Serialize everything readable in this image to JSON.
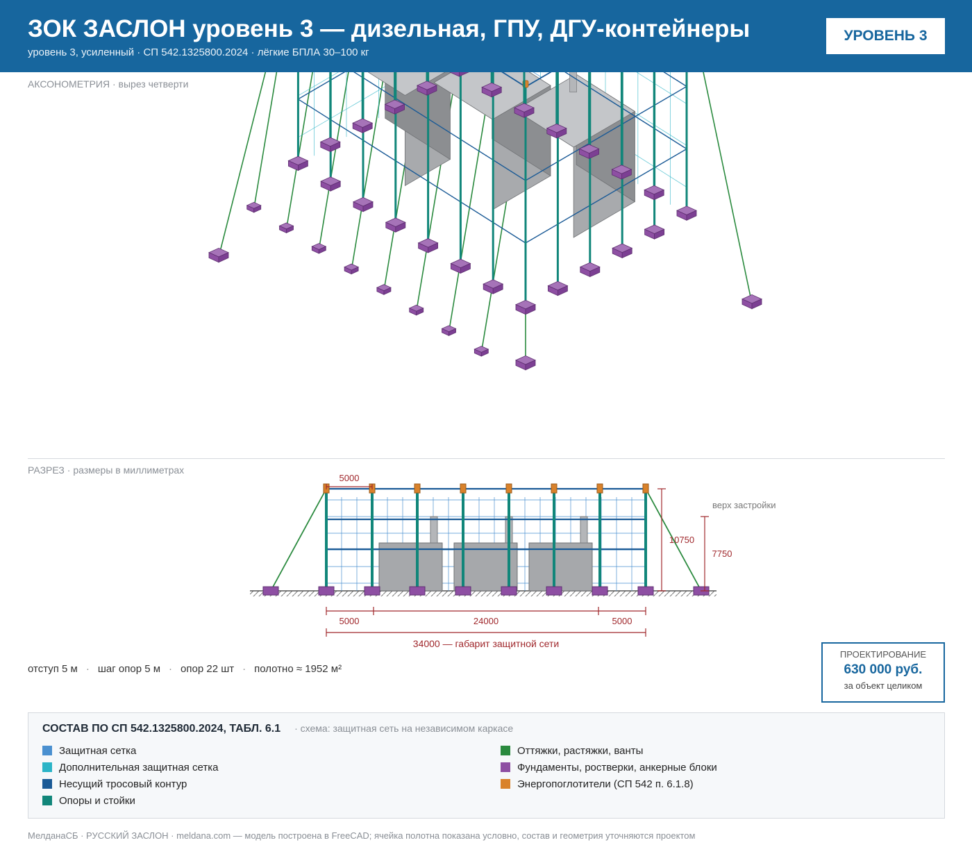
{
  "header": {
    "title": "ЗОК ЗАСЛОН уровень 3 — дизельная, ГПУ, ДГУ-контейнеры",
    "subtitle": "уровень 3, усиленный · СП 542.1325800.2024 · лёгкие БПЛА 30–100 кг",
    "badge": "УРОВЕНЬ 3"
  },
  "axo": {
    "label": "АКСОНОМЕТРИЯ",
    "sublabel": " · вырез четверти"
  },
  "section": {
    "label": "РАЗРЕЗ",
    "sublabel": " · размеры в миллиметрах",
    "dim_top": "5000",
    "dim_height_total": "10750",
    "dim_height_building": "7750",
    "building_top_label": "верх застройки",
    "dim_left": "5000",
    "dim_middle": "24000",
    "dim_right": "5000",
    "dim_total": "34000 — габарит защитной сети"
  },
  "stats": {
    "offset": "отступ 5 м",
    "pitch": "шаг опор 5 м",
    "supports": "опор 22 шт",
    "area": "полотно ≈ 1952 м²"
  },
  "price": {
    "label": "ПРОЕКТИРОВАНИЕ",
    "value": "630 000 руб.",
    "note": "за объект целиком"
  },
  "legend": {
    "title": "СОСТАВ ПО СП 542.1325800.2024, ТАБЛ. 6.1",
    "scheme": "· схема: защитная сеть на независимом каркасе",
    "items": [
      {
        "label": "Защитная сетка",
        "color": "#4a90d0"
      },
      {
        "label": "Дополнительная защитная сетка",
        "color": "#2bb4c7"
      },
      {
        "label": "Несущий тросовый контур",
        "color": "#1a5a96"
      },
      {
        "label": "Опоры и стойки",
        "color": "#11867a"
      },
      {
        "label": "Оттяжки, растяжки, ванты",
        "color": "#2a8a3e"
      },
      {
        "label": "Фундаменты, ростверки, анкерные блоки",
        "color": "#8e4fa3"
      },
      {
        "label": "Энергопоглотители (СП 542 п. 6.1.8)",
        "color": "#d9822b"
      }
    ]
  },
  "footer": "МелданаСБ · РУССКИЙ ЗАСЛОН · meldana.com — модель построена в FreeCAD; ячейка полотна показана условно, состав и геометрия уточняются проектом"
}
